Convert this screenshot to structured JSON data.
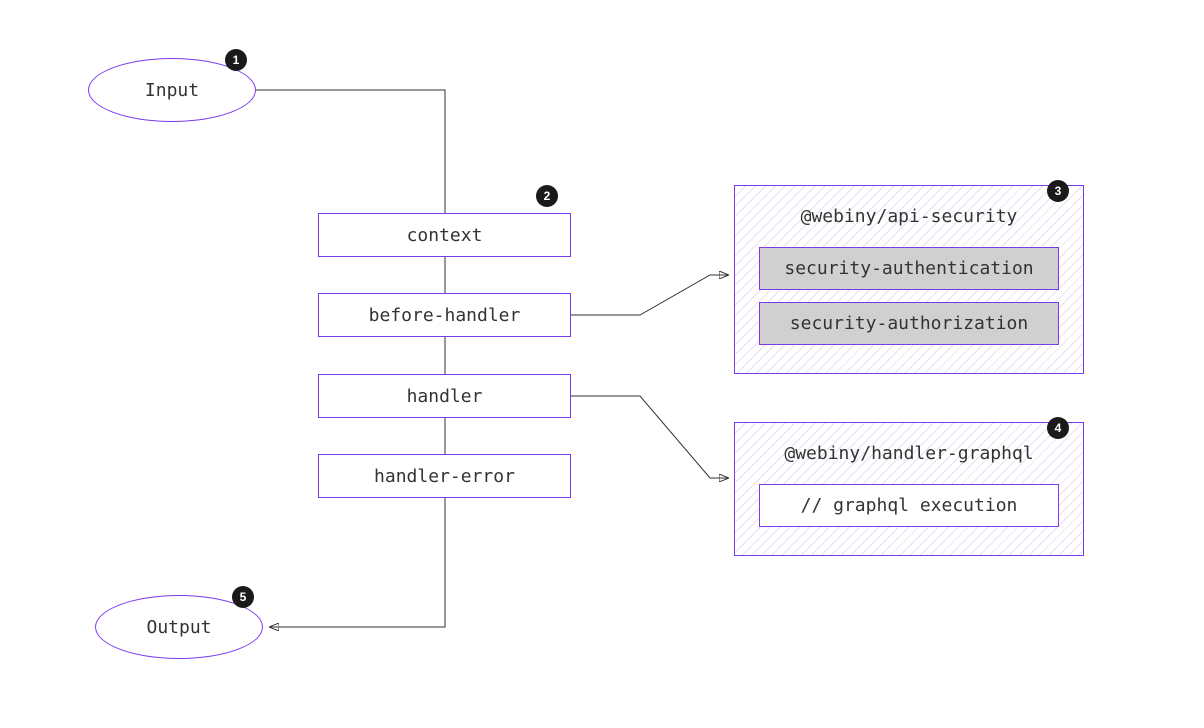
{
  "nodes": {
    "input": {
      "label": "Input"
    },
    "output": {
      "label": "Output"
    },
    "pipeline": {
      "step1": "context",
      "step2": "before-handler",
      "step3": "handler",
      "step4": "handler-error"
    },
    "packages": {
      "security": {
        "title": "@webiny/api-security",
        "items": [
          "security-authentication",
          "security-authorization"
        ]
      },
      "graphql": {
        "title": "@webiny/handler-graphql",
        "items": [
          "// graphql execution"
        ]
      }
    }
  },
  "badges": {
    "b1": "1",
    "b2": "2",
    "b3": "3",
    "b4": "4",
    "b5": "5"
  },
  "colors": {
    "accent": "#7c3aed",
    "badge_bg": "#1a1a1a",
    "fill_gray": "#d0d0d0"
  }
}
